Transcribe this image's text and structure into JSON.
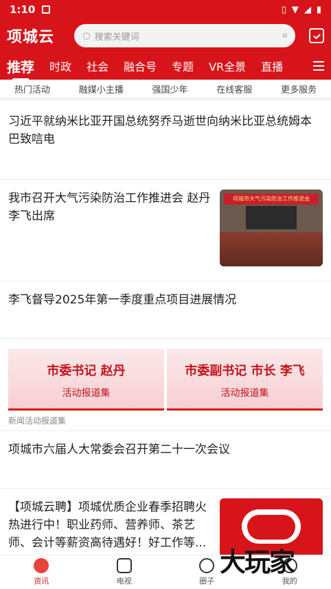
{
  "status": {
    "time": "1:10"
  },
  "app": {
    "logo": "项城云"
  },
  "search": {
    "placeholder": "搜索关键词"
  },
  "channels": [
    "推荐",
    "时政",
    "社会",
    "融合号",
    "专题",
    "VR全景",
    "直播"
  ],
  "subnav": [
    "热门活动",
    "融媒小主播",
    "强国少年",
    "在线客服",
    "更多服务"
  ],
  "feed": {
    "item1": "习近平就纳米比亚开国总统努乔马逝世向纳米比亚总统姆本巴致唁电",
    "item2": "我市召开大气污染防治工作推进会 赵丹 李飞出席",
    "item2_banner": "项城市大气污染防治工作推进会",
    "item3": "李飞督导2025年第一季度重点项目进展情况",
    "banner_left_title": "市委书记 赵丹",
    "banner_left_sub": "活动报道集",
    "banner_right_title": "市委副书记 市长 李飞",
    "banner_right_sub": "活动报道集",
    "banner_caption": "新闻活动报道集",
    "item4": "项城市六届人大常委会召开第二十一次会议",
    "item5": "【项城云聘】项城优质企业春季招聘火热进行中！职业药师、营养师、茶艺师、会计等薪资高待遇好！好工作等..."
  },
  "tabs": [
    "资讯",
    "电视",
    "圈子",
    "我的"
  ],
  "watermark": "大玩家",
  "colors": {
    "brand": "#d8141b"
  }
}
